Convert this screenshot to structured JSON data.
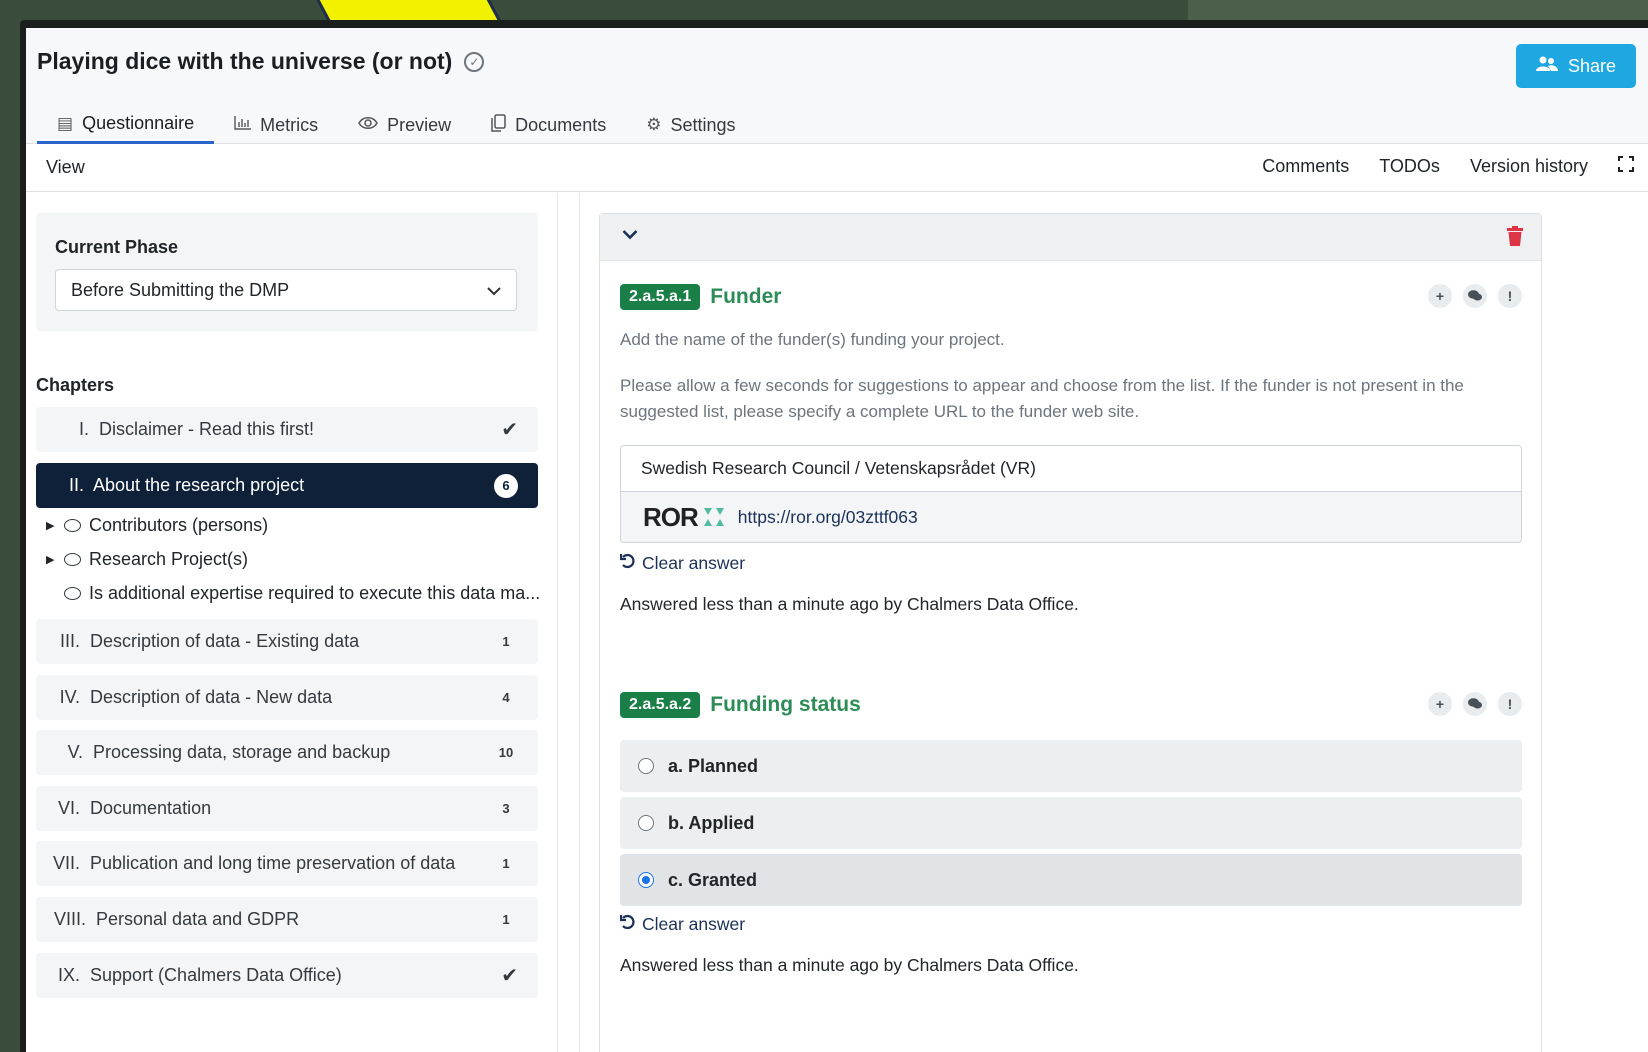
{
  "project": {
    "title": "Playing dice with the universe (or not)",
    "share_label": "Share"
  },
  "tabs": [
    {
      "label": "Questionnaire",
      "icon": "list-icon"
    },
    {
      "label": "Metrics",
      "icon": "bar-chart-icon"
    },
    {
      "label": "Preview",
      "icon": "eye-icon"
    },
    {
      "label": "Documents",
      "icon": "copy-icon"
    },
    {
      "label": "Settings",
      "icon": "gears-icon"
    }
  ],
  "subbar": {
    "view_label": "View",
    "comments_label": "Comments",
    "todos_label": "TODOs",
    "version_history_label": "Version history"
  },
  "phase": {
    "label": "Current Phase",
    "selected": "Before Submitting the DMP"
  },
  "chapters": {
    "label": "Chapters",
    "items": [
      {
        "num": "I.",
        "title": "Disclaimer - Read this first!",
        "status": "check"
      },
      {
        "num": "II.",
        "title": "About the research project",
        "count": "6",
        "active": true
      },
      {
        "num": "III.",
        "title": "Description of data - Existing data",
        "count": "1"
      },
      {
        "num": "IV.",
        "title": "Description of data - New data",
        "count": "4"
      },
      {
        "num": "V.",
        "title": "Processing data, storage and backup",
        "count": "10"
      },
      {
        "num": "VI.",
        "title": "Documentation",
        "count": "3"
      },
      {
        "num": "VII.",
        "title": "Publication and long time preservation of data",
        "count": "1"
      },
      {
        "num": "VIII.",
        "title": "Personal data and GDPR",
        "count": "1"
      },
      {
        "num": "IX.",
        "title": "Support (Chalmers Data Office)",
        "status": "check"
      }
    ],
    "subitems": [
      {
        "label": "Contributors (persons)",
        "expandable": true
      },
      {
        "label": "Research Project(s)",
        "expandable": true
      },
      {
        "label": "Is additional expertise required to execute this data ma...",
        "expandable": false
      }
    ]
  },
  "questions": {
    "funder": {
      "code": "2.a.5.a.1",
      "name": "Funder",
      "help1": "Add the name of the funder(s) funding your project.",
      "help2": "Please allow a few seconds for suggestions to appear and choose from the list. If the funder is not present in the suggested list, please specify a complete URL to the funder web site.",
      "answer": "Swedish Research Council / Vetenskapsrådet (VR)",
      "ror_logo": "ROR",
      "ror_url": "https://ror.org/03zttf063",
      "clear_label": "Clear answer",
      "answered": "Answered less than a minute ago by Chalmers Data Office."
    },
    "funding_status": {
      "code": "2.a.5.a.2",
      "name": "Funding status",
      "options": [
        "a. Planned",
        "b. Applied",
        "c. Granted"
      ],
      "selected": "c. Granted",
      "clear_label": "Clear answer",
      "answered": "Answered less than a minute ago by Chalmers Data Office."
    }
  },
  "colors": {
    "accent": "#1ea7e1",
    "active_chapter": "#0e2138",
    "question_code": "#1a7f46",
    "danger": "#dc3545"
  }
}
